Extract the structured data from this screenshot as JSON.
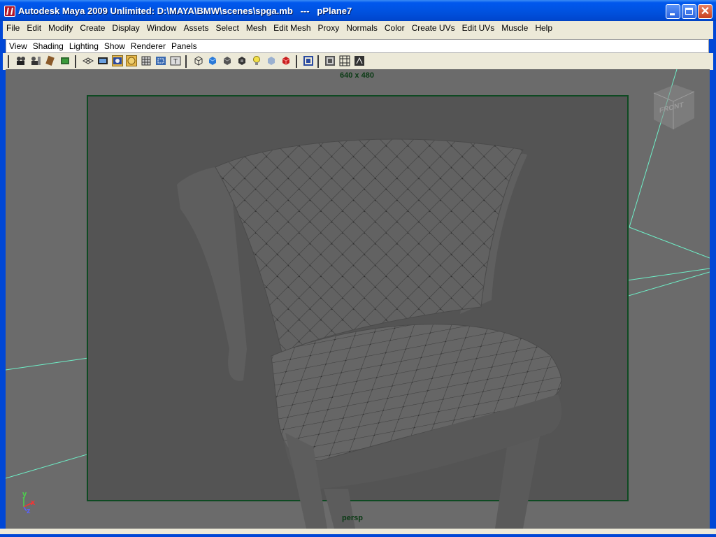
{
  "window": {
    "title": "Autodesk Maya 2009 Unlimited: D:\\MAYA\\BMW\\scenes\\spga.mb   ---   pPlane7"
  },
  "menubar": {
    "items": [
      "File",
      "Edit",
      "Modify",
      "Create",
      "Display",
      "Window",
      "Assets",
      "Select",
      "Mesh",
      "Edit Mesh",
      "Proxy",
      "Normals",
      "Color",
      "Create UVs",
      "Edit UVs",
      "Muscle",
      "Help"
    ]
  },
  "panel_menu": {
    "items": [
      "View",
      "Shading",
      "Lighting",
      "Show",
      "Renderer",
      "Panels"
    ]
  },
  "viewport": {
    "resolution_label": "640 x 480",
    "camera_label": "persp",
    "viewcube_label": "FRONT",
    "axis": {
      "y": "y",
      "x": "x",
      "z": "z"
    }
  },
  "colors": {
    "title_bar": "#0058ee",
    "viewport_bg": "#6b6b6b",
    "resolution_gate": "#0e4a22",
    "grid_line": "#6ef0c8"
  },
  "icons": {
    "toolbar": [
      "camera-icon",
      "camera-attributes-icon",
      "bookmark-icon",
      "image-plane-icon",
      "grid-icon",
      "film-gate-icon",
      "resolution-gate-icon",
      "gate-mask-icon",
      "field-chart-icon",
      "safe-action-icon",
      "safe-title-icon",
      "wireframe-icon",
      "smooth-shade-icon",
      "flat-shade-icon",
      "bounding-box-icon",
      "light-icon",
      "textured-icon",
      "shadows-icon",
      "isolate-select-icon",
      "xray-icon",
      "xray-joints-icon",
      "backface-icon"
    ]
  }
}
